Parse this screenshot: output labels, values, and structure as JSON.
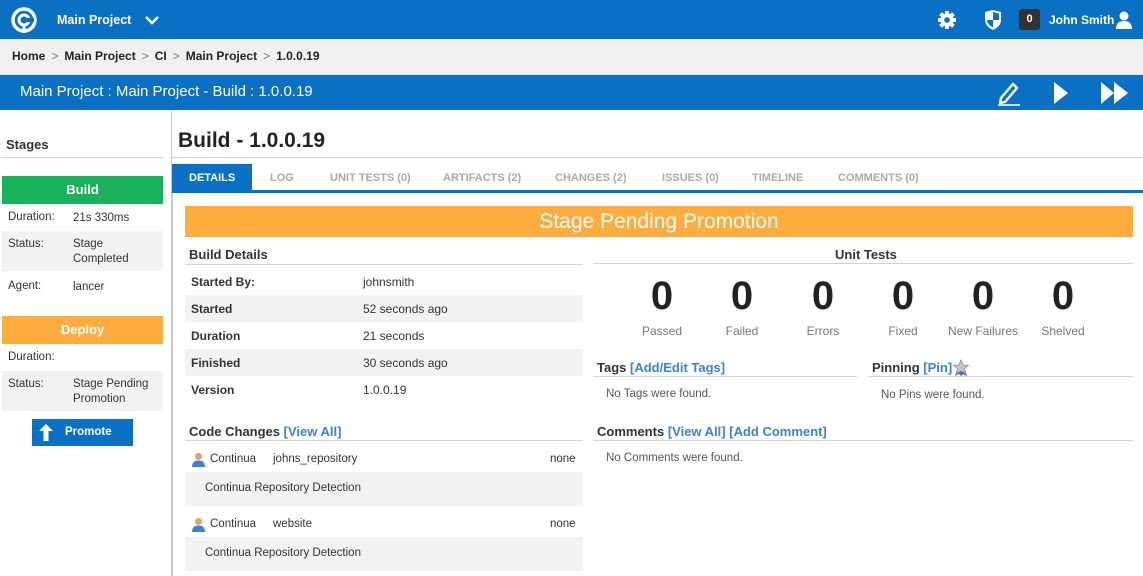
{
  "topbar": {
    "project": "Main Project",
    "badge_count": "0",
    "user": "John Smith",
    "colors": {
      "primary": "#0a70c4",
      "badge": "#333333"
    },
    "icons": [
      "continua-logo-icon",
      "chevron-down-icon",
      "gear-icon",
      "shield-icon",
      "user-icon"
    ]
  },
  "breadcrumb": [
    "Home",
    "Main Project",
    "CI",
    "Main Project",
    "1.0.0.19"
  ],
  "titlebar": {
    "header": "Main Project : Main Project - Build : 1.0.0.19",
    "icons": [
      "edit-pencil-icon",
      "play-icon",
      "fast-forward-icon"
    ]
  },
  "sidebar": {
    "title": "Stages",
    "stages": [
      {
        "name": "Build",
        "color": "#19b15a",
        "rows": [
          {
            "label": "Duration:",
            "value": "21s 330ms"
          },
          {
            "label": "Status:",
            "value": "Stage Completed"
          },
          {
            "label": "Agent:",
            "value": "lancer"
          }
        ]
      },
      {
        "name": "Deploy",
        "color": "#ffac3f",
        "rows": [
          {
            "label": "Duration:",
            "value": ""
          },
          {
            "label": "Status:",
            "value": "Stage Pending Promotion"
          }
        ]
      }
    ],
    "promote_button": "Promote"
  },
  "main": {
    "title": "Build - 1.0.0.19",
    "tabs": [
      "DETAILS",
      "LOG",
      "UNIT TESTS (0)",
      "ARTIFACTS (2)",
      "CHANGES (2)",
      "ISSUES (0)",
      "TIMELINE",
      "COMMENTS (0)"
    ],
    "active_tab": "DETAILS",
    "banner": "Stage Pending Promotion",
    "banner_color": "#ffac3f",
    "build_details": {
      "title": "Build Details",
      "rows": [
        {
          "label": "Started By:",
          "value": "johnsmith"
        },
        {
          "label": "Started",
          "value": "52 seconds ago"
        },
        {
          "label": "Duration",
          "value": "21 seconds"
        },
        {
          "label": "Finished",
          "value": "30 seconds ago"
        },
        {
          "label": "Version",
          "value": "1.0.0.19"
        }
      ]
    },
    "unit_tests": {
      "title": "Unit Tests",
      "stats": [
        {
          "value": "0",
          "label": "Passed"
        },
        {
          "value": "0",
          "label": "Failed"
        },
        {
          "value": "0",
          "label": "Errors"
        },
        {
          "value": "0",
          "label": "Fixed"
        },
        {
          "value": "0",
          "label": "New Failures"
        },
        {
          "value": "0",
          "label": "Shelved"
        }
      ]
    },
    "tags": {
      "title": "Tags",
      "link": "[Add/Edit Tags]",
      "empty": "No Tags were found."
    },
    "pinning": {
      "title": "Pinning",
      "link": "[Pin]",
      "empty": "No Pins were found."
    },
    "code_changes": {
      "title": "Code Changes",
      "link": "[View All]",
      "items": [
        {
          "author": "Continua",
          "repo": "johns_repository",
          "changes": "none",
          "message": "Continua Repository Detection"
        },
        {
          "author": "Continua",
          "repo": "website",
          "changes": "none",
          "message": "Continua Repository Detection"
        }
      ]
    },
    "comments": {
      "title": "Comments",
      "link_view": "[View All]",
      "link_add": "[Add Comment]",
      "empty": "No Comments were found."
    }
  }
}
